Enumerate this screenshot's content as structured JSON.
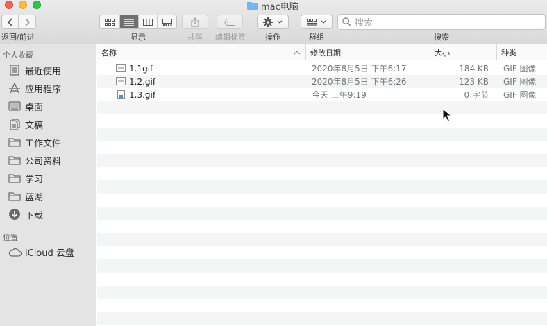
{
  "window": {
    "title": "mac电脑"
  },
  "toolbar": {
    "back_forward_label": "返回/前进",
    "view_label": "显示",
    "share_label": "共享",
    "tags_label": "编辑标签",
    "action_label": "操作",
    "group_label": "群组",
    "search_label": "搜索",
    "search_placeholder": "搜索"
  },
  "sidebar": {
    "favorites_header": "个人收藏",
    "favorites": [
      {
        "label": "最近使用",
        "icon": "recents-icon"
      },
      {
        "label": "应用程序",
        "icon": "applications-icon"
      },
      {
        "label": "桌面",
        "icon": "desktop-icon"
      },
      {
        "label": "文稿",
        "icon": "documents-icon"
      },
      {
        "label": "工作文件",
        "icon": "folder-icon"
      },
      {
        "label": "公司资料",
        "icon": "folder-icon"
      },
      {
        "label": "学习",
        "icon": "folder-icon"
      },
      {
        "label": "蓝湖",
        "icon": "folder-icon"
      },
      {
        "label": "下载",
        "icon": "downloads-icon"
      }
    ],
    "locations_header": "位置",
    "locations": [
      {
        "label": "iCloud 云盘",
        "icon": "cloud-icon"
      }
    ]
  },
  "list": {
    "columns": {
      "name": "名称",
      "date": "修改日期",
      "size": "大小",
      "kind": "种类"
    },
    "files": [
      {
        "name": "1.1gif",
        "date": "2020年8月5日 下午6:17",
        "size": "184 KB",
        "kind": "GIF 图像",
        "icon": "image-file-icon"
      },
      {
        "name": "1.2.gif",
        "date": "2020年8月5日 下午6:26",
        "size": "123 KB",
        "kind": "GIF 图像",
        "icon": "image-file-icon"
      },
      {
        "name": "1.3.gif",
        "date": "今天 上午9:19",
        "size": "0 字节",
        "kind": "GIF 图像",
        "icon": "empty-file-icon"
      }
    ]
  }
}
